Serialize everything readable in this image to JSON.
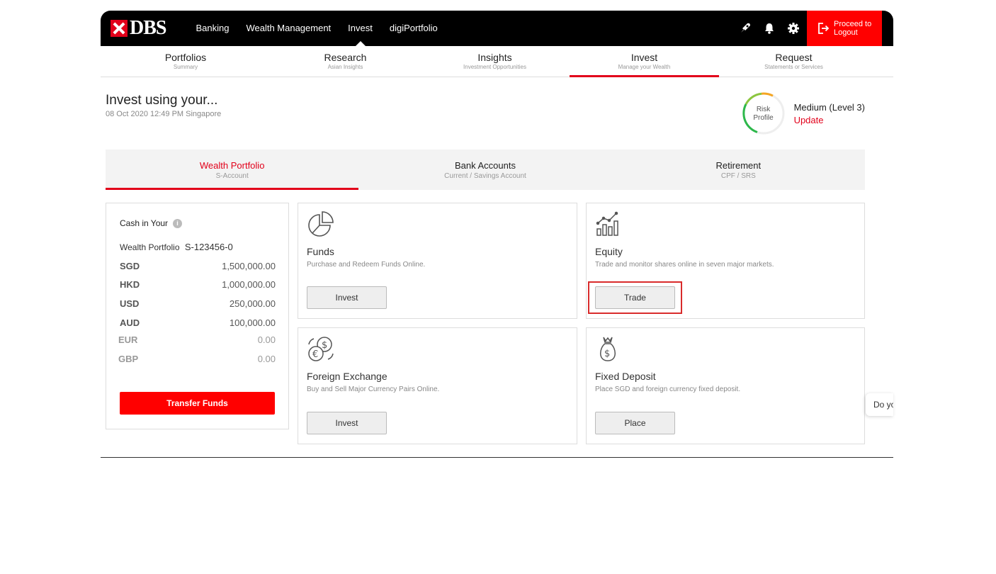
{
  "brand": {
    "name": "DBS"
  },
  "topnav": {
    "items": [
      {
        "label": "Banking"
      },
      {
        "label": "Wealth Management"
      },
      {
        "label": "Invest"
      },
      {
        "label": "digiPortfolio"
      }
    ],
    "active": "Invest",
    "logout_label_1": "Proceed to",
    "logout_label_2": "Logout"
  },
  "subnav": {
    "items": [
      {
        "title": "Portfolios",
        "sub": "Summary"
      },
      {
        "title": "Research",
        "sub": "Asian Insights"
      },
      {
        "title": "Insights",
        "sub": "Investment Opportunities"
      },
      {
        "title": "Invest",
        "sub": "Manage your Wealth"
      },
      {
        "title": "Request",
        "sub": "Statements or Services"
      }
    ],
    "active": "Invest"
  },
  "header": {
    "title": "Invest using your...",
    "date": "08 Oct 2020 12:49 PM Singapore"
  },
  "risk": {
    "label_1": "Risk",
    "label_2": "Profile",
    "level": "Medium (Level 3)",
    "update": "Update"
  },
  "account_tabs": [
    {
      "title": "Wealth Portfolio",
      "sub": "S-Account"
    },
    {
      "title": "Bank Accounts",
      "sub": "Current / Savings Account"
    },
    {
      "title": "Retirement",
      "sub": "CPF / SRS"
    }
  ],
  "cash": {
    "title": "Cash in Your",
    "account_label": "Wealth Portfolio",
    "account_number": "S-123456-0",
    "rows": [
      {
        "ccy": "SGD",
        "amount": "1,500,000.00"
      },
      {
        "ccy": "HKD",
        "amount": "1,000,000.00"
      },
      {
        "ccy": "USD",
        "amount": "250,000.00"
      },
      {
        "ccy": "AUD",
        "amount": "100,000.00"
      },
      {
        "ccy": "EUR",
        "amount": "0.00"
      },
      {
        "ccy": "GBP",
        "amount": "0.00"
      }
    ],
    "transfer_label": "Transfer Funds"
  },
  "products": [
    {
      "title": "Funds",
      "desc": "Purchase and Redeem Funds Online.",
      "button": "Invest",
      "icon": "pie-chart-icon"
    },
    {
      "title": "Equity",
      "desc": "Trade and monitor shares online in seven major markets.",
      "button": "Trade",
      "icon": "bar-chart-icon"
    },
    {
      "title": "Foreign Exchange",
      "desc": "Buy and Sell Major Currency Pairs Online.",
      "button": "Invest",
      "icon": "currency-exchange-icon"
    },
    {
      "title": "Fixed Deposit",
      "desc": "Place SGD and foreign currency fixed deposit.",
      "button": "Place",
      "icon": "money-bag-icon"
    }
  ],
  "chat_peek": "Do you",
  "colors": {
    "brand_red": "#e2001a",
    "logout_red": "#ff0000",
    "highlight": "#d92b2b"
  }
}
